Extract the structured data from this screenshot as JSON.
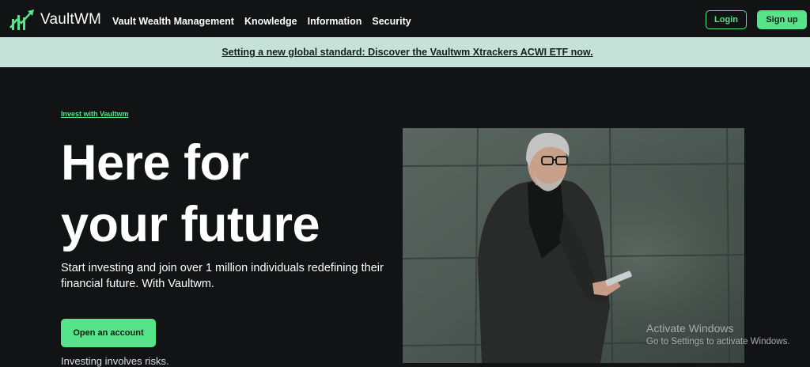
{
  "brand": {
    "name": "VaultWM",
    "accent": "#56e389",
    "background": "#121315"
  },
  "nav": {
    "items": [
      "Vault Wealth Management",
      "Knowledge",
      "Information",
      "Security"
    ]
  },
  "auth": {
    "login_label": "Login",
    "signup_label": "Sign up"
  },
  "banner": {
    "text": "Setting a new global standard: Discover the Vaultwm Xtrackers ACWI ETF now.",
    "background": "#c6e1d7"
  },
  "hero": {
    "eyebrow": "Invest with Vaultwm",
    "title_line1": "Here for",
    "title_line2": "your future",
    "subtitle": "Start investing and join over 1 million individuals redefining their financial future. With Vaultwm.",
    "cta_label": "Open an account",
    "disclaimer": "Investing involves risks.",
    "image": "man-in-suit-holding-phone-photo"
  },
  "watermark": {
    "title": "Activate Windows",
    "subtitle": "Go to Settings to activate Windows."
  }
}
